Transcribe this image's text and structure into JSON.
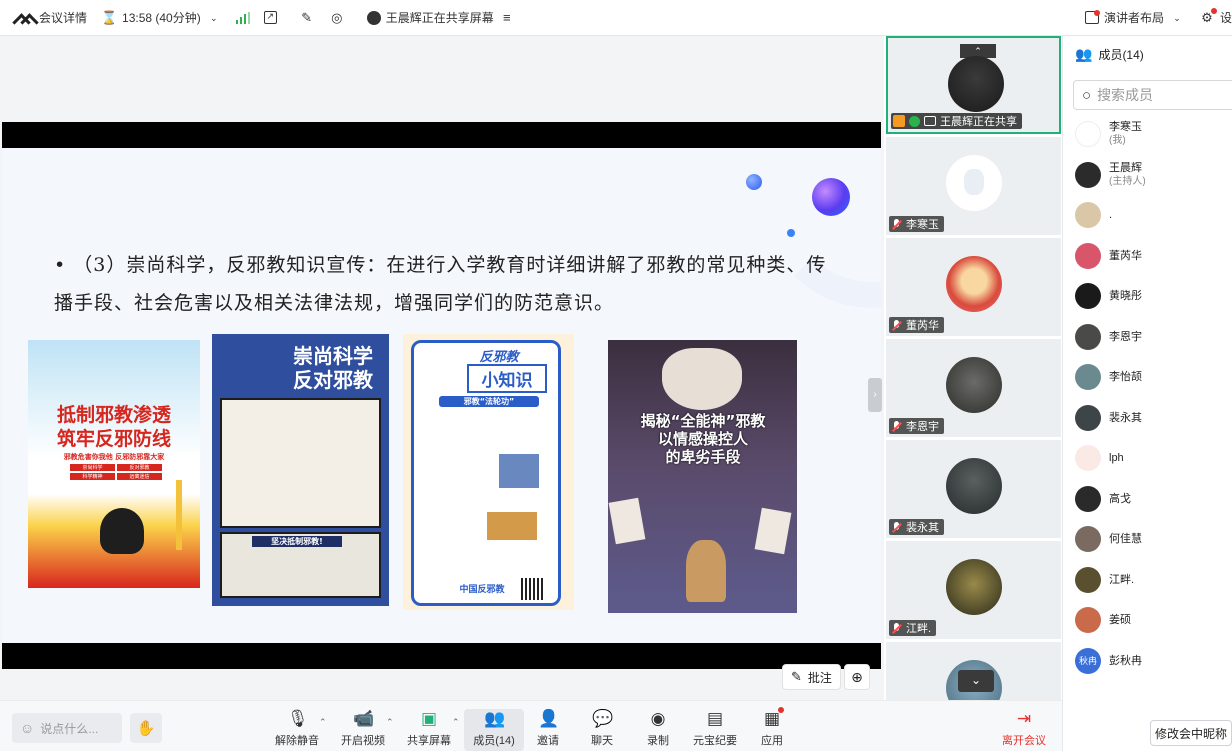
{
  "topbar": {
    "meeting_details": "会议详情",
    "timer": "13:58 (40分钟)",
    "sharing_status": "王晨辉正在共享屏幕",
    "layout": "演讲者布局",
    "settings": "设"
  },
  "slide": {
    "body_text": "• （3）崇尚科学，反邪教知识宣传：在进行入学教育时详细讲解了邪教的常见种类、传播手段、社会危害以及相关法律法规，增强同学们的防范意识。",
    "posters": [
      {
        "title_line1": "抵制邪教渗透",
        "title_line2": "筑牢反邪防线",
        "subtitle": "邪教危害你我他 反邪防邪靠大家",
        "tags": [
          "崇尚科学",
          "反对邪教",
          "科学精神",
          "远离迷信"
        ]
      },
      {
        "title_line1": "崇尚科学",
        "title_line2": "反对邪教",
        "banner": "坚决抵制邪教!"
      },
      {
        "title_line1": "反邪教",
        "title_line2": "小知识",
        "section": "邪教“法轮功”",
        "footer": "中国反邪教"
      },
      {
        "title_line1": "揭秘“全能神”邪教",
        "title_line2": "以情感操控人",
        "title_line3": "的卑劣手段"
      }
    ]
  },
  "annotate": {
    "label": "批注"
  },
  "video_tiles": [
    {
      "name": "王晨辉正在共享",
      "sharing": true
    },
    {
      "name": "李寒玉"
    },
    {
      "name": "董芮华"
    },
    {
      "name": "李恩宇"
    },
    {
      "name": "裴永其"
    },
    {
      "name": "江畔."
    },
    {
      "name": ""
    }
  ],
  "members": {
    "header": "成员(14)",
    "search_placeholder": "搜索成员",
    "list": [
      {
        "name": "李寒玉",
        "sub": "(我)",
        "color": "#ffffff"
      },
      {
        "name": "王晨辉",
        "sub": "(主持人)",
        "color": "#2b2b2b"
      },
      {
        "name": ".",
        "sub": "",
        "color": "#d9c7a8"
      },
      {
        "name": "董芮华",
        "sub": "",
        "color": "#d9556a"
      },
      {
        "name": "黄晓彤",
        "sub": "",
        "color": "#1a1a1a"
      },
      {
        "name": "李恩宇",
        "sub": "",
        "color": "#4a4a48"
      },
      {
        "name": "李怡颉",
        "sub": "",
        "color": "#6a8a90"
      },
      {
        "name": "裴永其",
        "sub": "",
        "color": "#3d4548"
      },
      {
        "name": "lph",
        "sub": "",
        "color": "#fbe9e6"
      },
      {
        "name": "高戈",
        "sub": "",
        "color": "#2a2a2a"
      },
      {
        "name": "何佳慧",
        "sub": "",
        "color": "#7a6a60"
      },
      {
        "name": "江畔.",
        "sub": "",
        "color": "#5a5030"
      },
      {
        "name": "姜硕",
        "sub": "",
        "color": "#c96a4a"
      },
      {
        "name": "彭秋冉",
        "sub": "",
        "color": "#3b6fd8",
        "initials": "秋冉"
      }
    ],
    "rename_button": "修改会中昵称"
  },
  "toolbar": {
    "chat_placeholder": "说点什么...",
    "items": [
      {
        "label": "解除静音"
      },
      {
        "label": "开启视频"
      },
      {
        "label": "共享屏幕"
      },
      {
        "label": "成员(14)"
      },
      {
        "label": "邀请"
      },
      {
        "label": "聊天"
      },
      {
        "label": "录制"
      },
      {
        "label": "元宝纪要"
      },
      {
        "label": "应用"
      },
      {
        "label": "离开会议"
      }
    ]
  },
  "colors": {
    "accent_green": "#21b07a",
    "leave_red": "#e5322d",
    "slide_bg": "#f4f7fc"
  }
}
